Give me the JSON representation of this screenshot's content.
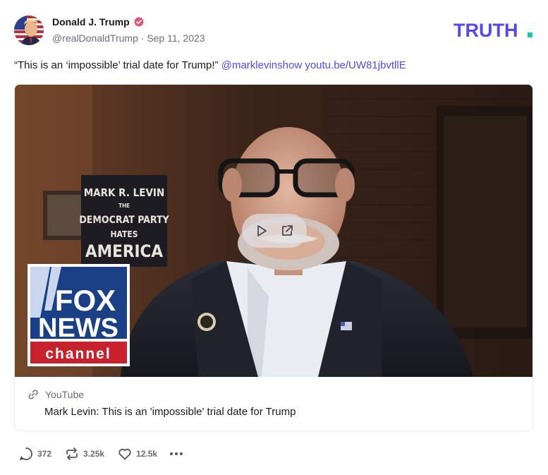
{
  "author": {
    "display_name": "Donald J. Trump",
    "handle": "@realDonaldTrump",
    "separator": "·",
    "date": "Sep 11, 2023",
    "verified": true
  },
  "brand": {
    "logo_text": "TRUTH",
    "logo_dot": ".",
    "accent_color": "#5448ee",
    "dot_color": "#19c7b1"
  },
  "post": {
    "text": "“This is an ‘impossible’ trial date for Trump!”",
    "mention": "@marklevinshow",
    "url": "youtu.be/UW81jbvtllE"
  },
  "media": {
    "book_lines": [
      "MARK R. LEVIN",
      "THE",
      "DEMOCRAT PARTY",
      "HATES",
      "AMERICA"
    ],
    "network_logo": [
      "FOX",
      "NEWS",
      "channel"
    ],
    "play_icon": "play-icon",
    "external_icon": "external-link-icon"
  },
  "card": {
    "provider": "YouTube",
    "title": "Mark Levin: This is an 'impossible' trial date for Trump"
  },
  "actions": {
    "replies": "372",
    "retruths": "3.25k",
    "likes": "12.5k"
  }
}
